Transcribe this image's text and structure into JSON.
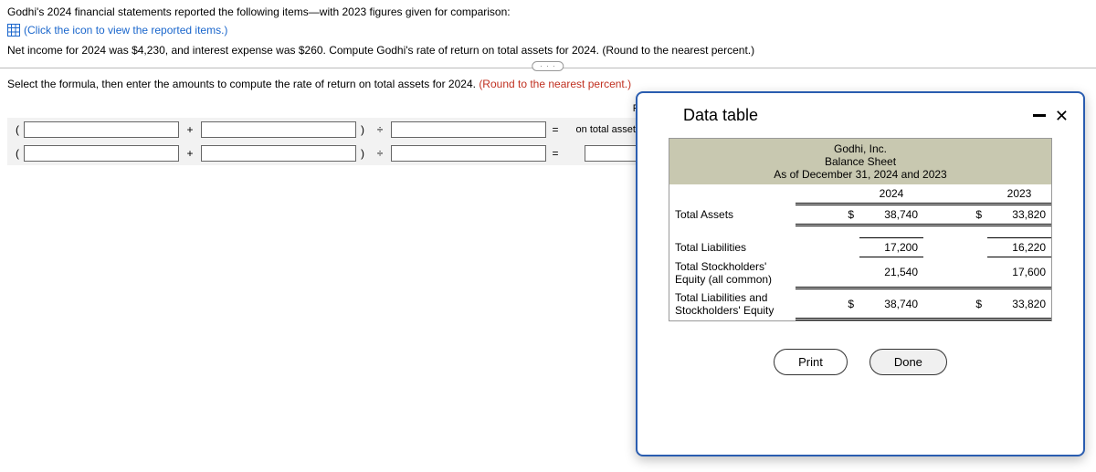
{
  "intro": {
    "line1": "Godhi's 2024 financial statements reported the following items—with 2023 figures given for comparison:",
    "view_link": "(Click the icon to view the reported items.)",
    "line3": "Net income for 2024 was $4,230, and interest expense was $260. Compute Godhi's rate of return on total assets for 2024. (Round to the nearest percent.)"
  },
  "ellipsis": "· · ·",
  "instr": {
    "black": "Select the formula, then enter the amounts to compute the rate of return on total assets for 2024. ",
    "red": "(Round to the nearest percent.)"
  },
  "formula": {
    "rate_label1": "Rate of return",
    "rate_label2": "on total assets",
    "plus": "+",
    "div": "÷",
    "eq": "=",
    "pct": "%"
  },
  "modal": {
    "title": "Data table",
    "header": {
      "company": "Godhi, Inc.",
      "sheet": "Balance Sheet",
      "asof": "As of December 31, 2024 and 2023"
    },
    "cols": {
      "y1": "2024",
      "y2": "2023"
    },
    "rows": {
      "total_assets": {
        "label": "Total Assets",
        "y1_cur": "$",
        "y1": "38,740",
        "y2_cur": "$",
        "y2": "33,820"
      },
      "total_liab": {
        "label": "Total Liabilities",
        "y1": "17,200",
        "y2": "16,220"
      },
      "total_se": {
        "label": "Total Stockholders' Equity (all common)",
        "y1": "21,540",
        "y2": "17,600"
      },
      "total_lse": {
        "label": "Total Liabilities and Stockholders' Equity",
        "y1_cur": "$",
        "y1": "38,740",
        "y2_cur": "$",
        "y2": "33,820"
      }
    },
    "print": "Print",
    "done": "Done"
  }
}
